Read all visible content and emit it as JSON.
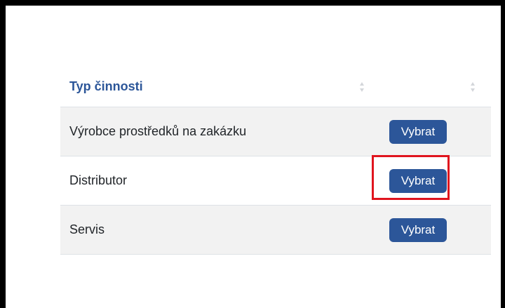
{
  "table": {
    "header": {
      "column_label": "Typ činnosti"
    },
    "rows": [
      {
        "label": "Výrobce prostředků na zakázku",
        "button_label": "Vybrat"
      },
      {
        "label": "Distributor",
        "button_label": "Vybrat"
      },
      {
        "label": "Servis",
        "button_label": "Vybrat"
      }
    ]
  },
  "colors": {
    "accent": "#2c5699",
    "highlight": "#e0141e",
    "row_stripe": "#f2f2f2"
  },
  "icons": {
    "sort": "sort-icon"
  }
}
